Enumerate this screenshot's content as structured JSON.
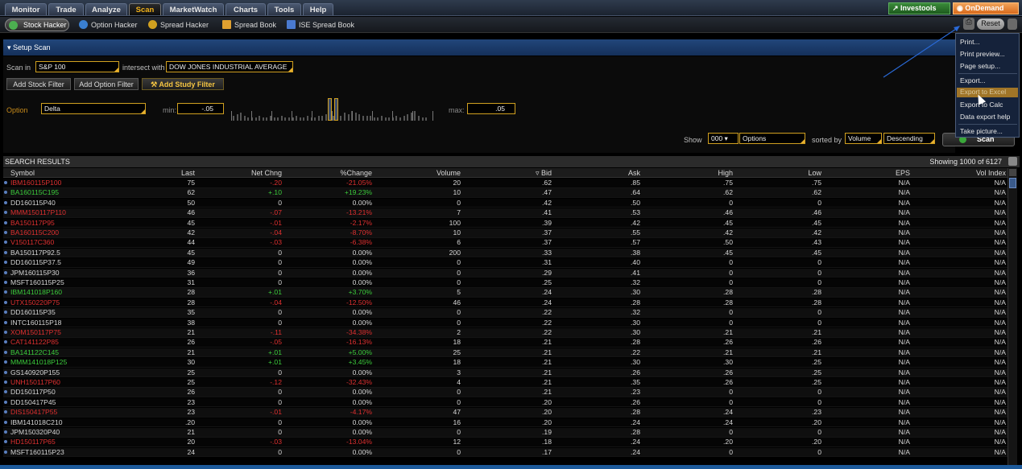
{
  "menubar": {
    "tabs": [
      "Monitor",
      "Trade",
      "Analyze",
      "Scan",
      "MarketWatch",
      "Charts",
      "Tools",
      "Help"
    ],
    "active_tab": "Scan",
    "investools": "Investools",
    "ondemand": "OnDemand"
  },
  "subbar": {
    "tabs": [
      "Stock Hacker",
      "Option Hacker",
      "Spread Hacker",
      "Spread Book",
      "ISE Spread Book"
    ],
    "active_tab": "Stock Hacker",
    "reset": "Reset"
  },
  "setup": {
    "title": "Setup Scan",
    "scan_in_label": "Scan in",
    "scan_in_value": "S&P 100",
    "intersect_label": "intersect with",
    "intersect_value": "DOW JONES INDUSTRIAL AVERAGE",
    "add_stock_filter": "Add Stock Filter",
    "add_option_filter": "Add Option Filter",
    "add_study_filter": "Add Study Filter",
    "option_label": "Option",
    "option_value": "Delta",
    "min_label": "min:",
    "min_value": "-.05",
    "max_label": "max:",
    "max_value": ".05",
    "show_label": "Show",
    "show_value": "000",
    "show_type": "Options",
    "sorted_by_label": "sorted by",
    "sorted_by_value": "Volume",
    "order_value": "Descending",
    "scan_button": "Scan"
  },
  "results": {
    "title": "SEARCH RESULTS",
    "showing": "Showing 1000 of 6127",
    "columns": [
      "Symbol",
      "Last",
      "Net Chng",
      "%Change",
      "Volume",
      "Bid",
      "Ask",
      "High",
      "Low",
      "EPS",
      "Vol Index"
    ],
    "rows": [
      {
        "symbol": "IBM160115P100",
        "last": "75",
        "net": "-.20",
        "pct": "-21.05%",
        "vol": "20",
        "bid": ".62",
        "ask": ".85",
        "high": ".75",
        "low": ".75",
        "eps": "N/A",
        "vi": "N/A",
        "color": "red"
      },
      {
        "symbol": "BA160115C195",
        "last": "62",
        "net": "+.10",
        "pct": "+19.23%",
        "vol": "10",
        "bid": ".47",
        "ask": ".64",
        "high": ".62",
        "low": ".62",
        "eps": "N/A",
        "vi": "N/A",
        "color": "green"
      },
      {
        "symbol": "DD160115P40",
        "last": "50",
        "net": "0",
        "pct": "0.00%",
        "vol": "0",
        "bid": ".42",
        "ask": ".50",
        "high": "0",
        "low": "0",
        "eps": "N/A",
        "vi": "N/A",
        "color": ""
      },
      {
        "symbol": "MMM150117P110",
        "last": "46",
        "net": "-.07",
        "pct": "-13.21%",
        "vol": "7",
        "bid": ".41",
        "ask": ".53",
        "high": ".46",
        "low": ".46",
        "eps": "N/A",
        "vi": "N/A",
        "color": "red"
      },
      {
        "symbol": "BA150117P95",
        "last": "45",
        "net": "-.01",
        "pct": "-2.17%",
        "vol": "100",
        "bid": ".39",
        "ask": ".42",
        "high": ".45",
        "low": ".45",
        "eps": "N/A",
        "vi": "N/A",
        "color": "red"
      },
      {
        "symbol": "BA160115C200",
        "last": "42",
        "net": "-.04",
        "pct": "-8.70%",
        "vol": "10",
        "bid": ".37",
        "ask": ".55",
        "high": ".42",
        "low": ".42",
        "eps": "N/A",
        "vi": "N/A",
        "color": "red"
      },
      {
        "symbol": "V150117C360",
        "last": "44",
        "net": "-.03",
        "pct": "-6.38%",
        "vol": "6",
        "bid": ".37",
        "ask": ".57",
        "high": ".50",
        "low": ".43",
        "eps": "N/A",
        "vi": "N/A",
        "color": "red"
      },
      {
        "symbol": "BA150117P92.5",
        "last": "45",
        "net": "0",
        "pct": "0.00%",
        "vol": "200",
        "bid": ".33",
        "ask": ".38",
        "high": ".45",
        "low": ".45",
        "eps": "N/A",
        "vi": "N/A",
        "color": ""
      },
      {
        "symbol": "DD160115P37.5",
        "last": "49",
        "net": "0",
        "pct": "0.00%",
        "vol": "0",
        "bid": ".31",
        "ask": ".40",
        "high": "0",
        "low": "0",
        "eps": "N/A",
        "vi": "N/A",
        "color": ""
      },
      {
        "symbol": "JPM160115P30",
        "last": "36",
        "net": "0",
        "pct": "0.00%",
        "vol": "0",
        "bid": ".29",
        "ask": ".41",
        "high": "0",
        "low": "0",
        "eps": "N/A",
        "vi": "N/A",
        "color": ""
      },
      {
        "symbol": "MSFT160115P25",
        "last": "31",
        "net": "0",
        "pct": "0.00%",
        "vol": "0",
        "bid": ".25",
        "ask": ".32",
        "high": "0",
        "low": "0",
        "eps": "N/A",
        "vi": "N/A",
        "color": ""
      },
      {
        "symbol": "IBM141018P160",
        "last": "28",
        "net": "+.01",
        "pct": "+3.70%",
        "vol": "5",
        "bid": ".24",
        "ask": ".30",
        "high": ".28",
        "low": ".28",
        "eps": "N/A",
        "vi": "N/A",
        "color": "green"
      },
      {
        "symbol": "UTX150220P75",
        "last": "28",
        "net": "-.04",
        "pct": "-12.50%",
        "vol": "46",
        "bid": ".24",
        "ask": ".28",
        "high": ".28",
        "low": ".28",
        "eps": "N/A",
        "vi": "N/A",
        "color": "red"
      },
      {
        "symbol": "DD160115P35",
        "last": "35",
        "net": "0",
        "pct": "0.00%",
        "vol": "0",
        "bid": ".22",
        "ask": ".32",
        "high": "0",
        "low": "0",
        "eps": "N/A",
        "vi": "N/A",
        "color": ""
      },
      {
        "symbol": "INTC160115P18",
        "last": "38",
        "net": "0",
        "pct": "0.00%",
        "vol": "0",
        "bid": ".22",
        "ask": ".30",
        "high": "0",
        "low": "0",
        "eps": "N/A",
        "vi": "N/A",
        "color": ""
      },
      {
        "symbol": "XOM150117P75",
        "last": "21",
        "net": "-.11",
        "pct": "-34.38%",
        "vol": "2",
        "bid": ".22",
        "ask": ".30",
        "high": ".21",
        "low": ".21",
        "eps": "N/A",
        "vi": "N/A",
        "color": "red"
      },
      {
        "symbol": "CAT141122P85",
        "last": "26",
        "net": "-.05",
        "pct": "-16.13%",
        "vol": "18",
        "bid": ".21",
        "ask": ".28",
        "high": ".26",
        "low": ".26",
        "eps": "N/A",
        "vi": "N/A",
        "color": "red"
      },
      {
        "symbol": "BA141122C145",
        "last": "21",
        "net": "+.01",
        "pct": "+5.00%",
        "vol": "25",
        "bid": ".21",
        "ask": ".22",
        "high": ".21",
        "low": ".21",
        "eps": "N/A",
        "vi": "N/A",
        "color": "green"
      },
      {
        "symbol": "MMM141018P125",
        "last": "30",
        "net": "+.01",
        "pct": "+3.45%",
        "vol": "18",
        "bid": ".21",
        "ask": ".30",
        "high": ".30",
        "low": ".25",
        "eps": "N/A",
        "vi": "N/A",
        "color": "green"
      },
      {
        "symbol": "GS140920P155",
        "last": "25",
        "net": "0",
        "pct": "0.00%",
        "vol": "3",
        "bid": ".21",
        "ask": ".26",
        "high": ".26",
        "low": ".25",
        "eps": "N/A",
        "vi": "N/A",
        "color": ""
      },
      {
        "symbol": "UNH150117P60",
        "last": "25",
        "net": "-.12",
        "pct": "-32.43%",
        "vol": "4",
        "bid": ".21",
        "ask": ".35",
        "high": ".26",
        "low": ".25",
        "eps": "N/A",
        "vi": "N/A",
        "color": "red"
      },
      {
        "symbol": "DD150117P50",
        "last": "26",
        "net": "0",
        "pct": "0.00%",
        "vol": "0",
        "bid": ".21",
        "ask": ".23",
        "high": "0",
        "low": "0",
        "eps": "N/A",
        "vi": "N/A",
        "color": ""
      },
      {
        "symbol": "DD150417P45",
        "last": "23",
        "net": "0",
        "pct": "0.00%",
        "vol": "0",
        "bid": ".20",
        "ask": ".26",
        "high": "0",
        "low": "0",
        "eps": "N/A",
        "vi": "N/A",
        "color": ""
      },
      {
        "symbol": "DIS150417P55",
        "last": "23",
        "net": "-.01",
        "pct": "-4.17%",
        "vol": "47",
        "bid": ".20",
        "ask": ".28",
        "high": ".24",
        "low": ".23",
        "eps": "N/A",
        "vi": "N/A",
        "color": "red"
      },
      {
        "symbol": "IBM141018C210",
        "last": ".20",
        "net": "0",
        "pct": "0.00%",
        "vol": "16",
        "bid": ".20",
        "ask": ".24",
        "high": ".24",
        "low": ".20",
        "eps": "N/A",
        "vi": "N/A",
        "color": ""
      },
      {
        "symbol": "JPM150320P40",
        "last": "21",
        "net": "0",
        "pct": "0.00%",
        "vol": "0",
        "bid": ".19",
        "ask": ".28",
        "high": "0",
        "low": "0",
        "eps": "N/A",
        "vi": "N/A",
        "color": ""
      },
      {
        "symbol": "HD150117P65",
        "last": "20",
        "net": "-.03",
        "pct": "-13.04%",
        "vol": "12",
        "bid": ".18",
        "ask": ".24",
        "high": ".20",
        "low": ".20",
        "eps": "N/A",
        "vi": "N/A",
        "color": "red"
      },
      {
        "symbol": "MSFT160115P23",
        "last": "24",
        "net": "0",
        "pct": "0.00%",
        "vol": "0",
        "bid": ".17",
        "ask": ".24",
        "high": "0",
        "low": "0",
        "eps": "N/A",
        "vi": "N/A",
        "color": ""
      }
    ]
  },
  "dropdown": {
    "items": [
      "Print...",
      "Print preview...",
      "Page setup...",
      "Export...",
      "Export to Excel",
      "Export to Calc",
      "Data export help",
      "Take picture..."
    ],
    "highlighted": "Export to Excel"
  },
  "colors": {
    "accent": "#f2b21b",
    "up": "#3ccc3c",
    "down": "#e03030",
    "header_blue": "#21467a"
  }
}
